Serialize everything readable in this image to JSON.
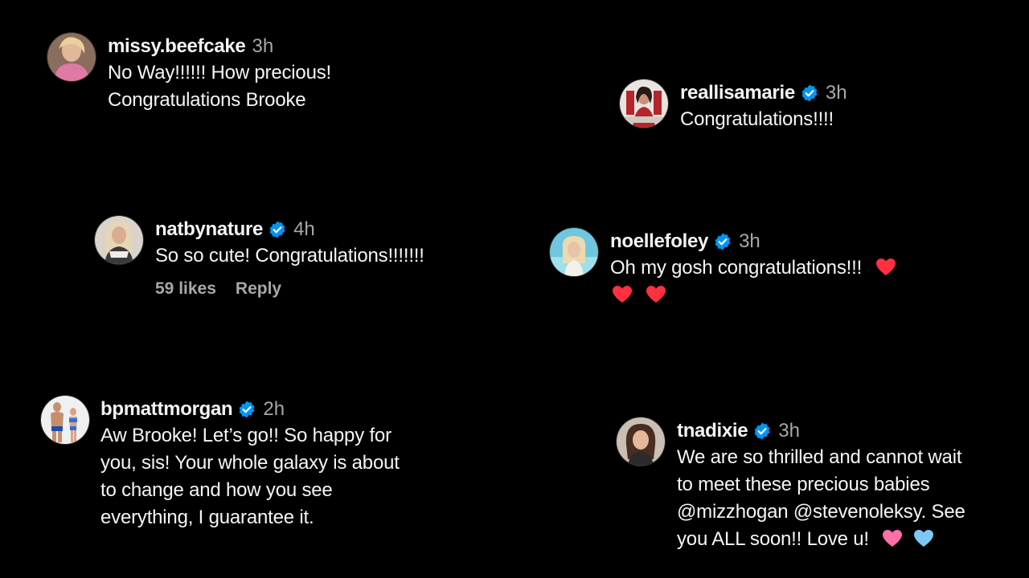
{
  "comments": [
    {
      "username": "missy.beefcake",
      "verified": false,
      "time": "3h",
      "lines": [
        "No Way!!!!!! How precious!",
        "Congratulations Brooke"
      ]
    },
    {
      "username": "reallisamarie",
      "verified": true,
      "time": "3h",
      "lines": [
        "Congratulations!!!!"
      ]
    },
    {
      "username": "natbynature",
      "verified": true,
      "time": "4h",
      "lines": [
        "So so cute! Congratulations!!!!!!!"
      ],
      "likes": "59 likes",
      "reply": "Reply"
    },
    {
      "username": "noellefoley",
      "verified": true,
      "time": "3h",
      "lines": [
        "Oh my gosh congratulations!!!"
      ],
      "hearts": [
        "red-heart",
        "red-heart",
        "red-heart"
      ]
    },
    {
      "username": "bpmattmorgan",
      "verified": true,
      "time": "2h",
      "lines": [
        "Aw Brooke! Let’s go!! So happy for",
        "you, sis! Your whole galaxy is about",
        "to change and how you see",
        "everything, I guarantee it."
      ]
    },
    {
      "username": "tnadixie",
      "verified": true,
      "time": "3h",
      "lines": [
        "We are so thrilled and cannot wait",
        "to meet these precious babies",
        "@mizzhogan @stevenoleksy. See",
        "you ALL soon!! Love u!"
      ],
      "hearts": [
        "pink-heart",
        "light-blue-heart"
      ]
    }
  ],
  "colors": {
    "background": "#000000",
    "text": "#f5f5f5",
    "muted": "#a8a8a8",
    "verified": "#0095f6",
    "red_heart": "#ff3040",
    "pink_heart": "#ff6fa8",
    "light_blue_heart": "#7ec8f5"
  }
}
